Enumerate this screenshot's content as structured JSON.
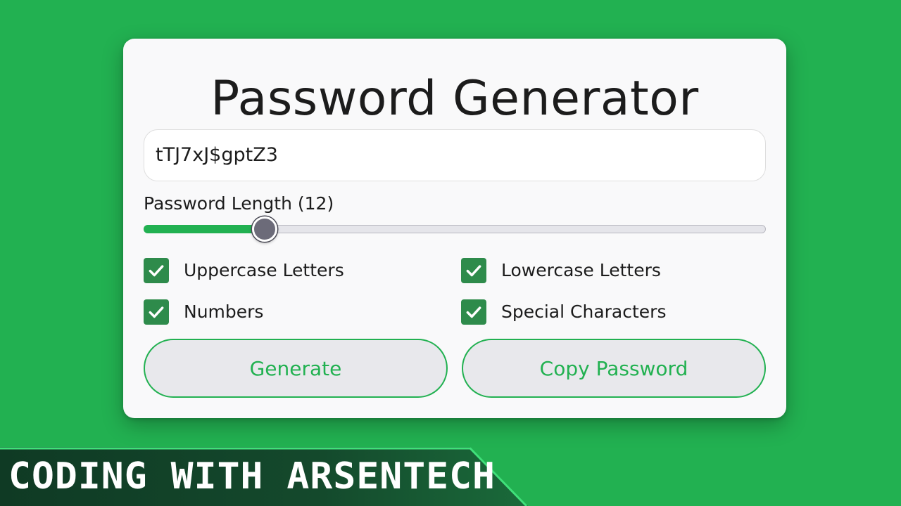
{
  "app": {
    "title": "Password Generator"
  },
  "password": {
    "value": "tTJ7xJ$gptZ3"
  },
  "length": {
    "label": "Password Length (12)",
    "value": 12,
    "fill_fraction": 0.195
  },
  "options": [
    {
      "label": "Uppercase Letters",
      "checked": true
    },
    {
      "label": "Lowercase Letters",
      "checked": true
    },
    {
      "label": "Numbers",
      "checked": true
    },
    {
      "label": "Special Characters",
      "checked": true
    }
  ],
  "buttons": {
    "generate_label": "Generate",
    "copy_label": "Copy Password"
  },
  "banner": {
    "text": "CODING WITH ARSENTECH"
  },
  "colors": {
    "background": "#22b151",
    "accent": "#22b151",
    "checkbox": "#2e8b4b",
    "thumb": "#6c6b79",
    "card": "#f9f9fa"
  },
  "icons": {
    "checkbox": "check-icon"
  }
}
